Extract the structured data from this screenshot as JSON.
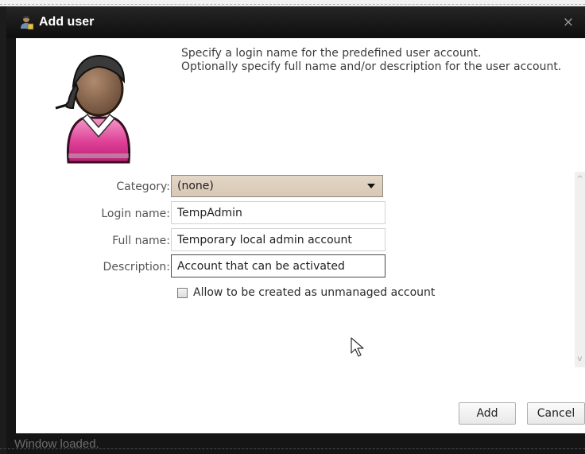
{
  "window": {
    "title": "Add user",
    "close_symbol": "×",
    "icon": "user-icon",
    "close_icon": "close-icon"
  },
  "intro": {
    "line1": "Specify a login name for the predefined user account.",
    "line2": "Optionally specify full name and/or description for the user account."
  },
  "avatar": {
    "icon": "user-avatar-icon",
    "colors": {
      "skin": "#8a6a52",
      "hair": "#2a2a2a",
      "shirt": "#e0479a"
    }
  },
  "form": {
    "category": {
      "label": "Category:",
      "value": "(none)"
    },
    "login_name": {
      "label": "Login name:",
      "value": "TempAdmin"
    },
    "full_name": {
      "label": "Full name:",
      "value": "Temporary local admin account"
    },
    "description": {
      "label": "Description:",
      "value": "Account that can be activated"
    },
    "unmanaged": {
      "label": "Allow to be created as unmanaged account",
      "checked": false
    }
  },
  "scrollbar": {
    "up_symbol": "^",
    "down_symbol": "v"
  },
  "buttons": {
    "add": "Add",
    "cancel": "Cancel"
  },
  "status": {
    "text": "Window loaded."
  },
  "colors": {
    "titlebar": "#151515",
    "content_bg": "#ffffff",
    "select_bg": "#e3d7c8"
  }
}
